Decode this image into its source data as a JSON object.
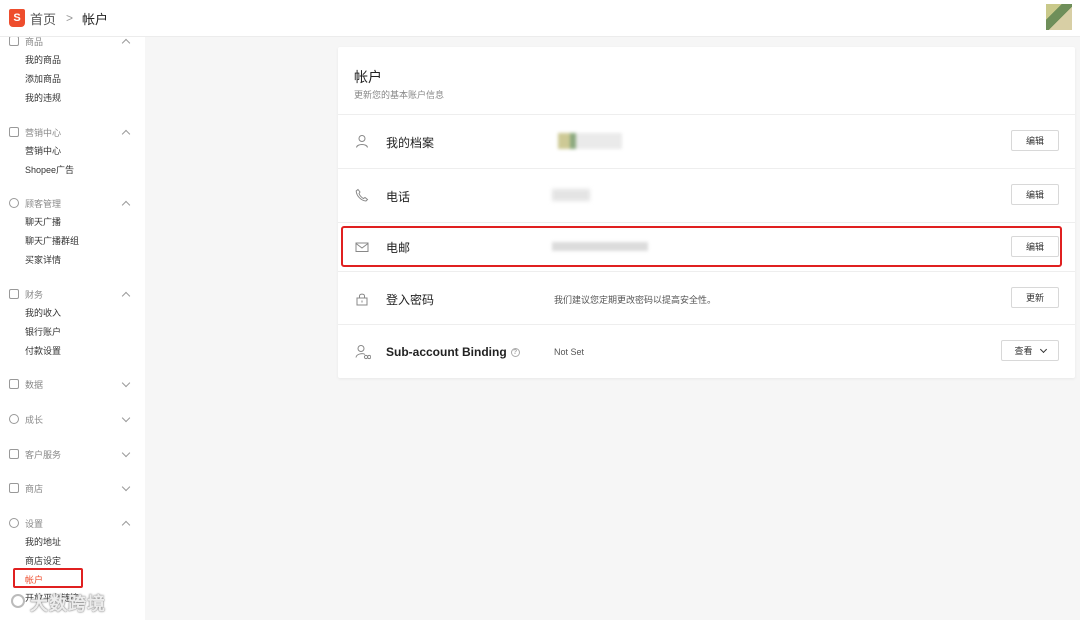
{
  "header": {
    "logo_letter": "S",
    "breadcrumb_home": "首页",
    "breadcrumb_sep": ">",
    "breadcrumb_current": "帐户"
  },
  "sidebar": {
    "groups": [
      {
        "label": "商品",
        "expanded": true,
        "items": [
          "我的商品",
          "添加商品",
          "我的违规"
        ]
      },
      {
        "label": "营销中心",
        "expanded": true,
        "items": [
          "营销中心",
          "Shopee广告"
        ]
      },
      {
        "label": "顾客管理",
        "expanded": true,
        "items": [
          "聊天广播",
          "聊天广播群组",
          "买家详情"
        ]
      },
      {
        "label": "财务",
        "expanded": true,
        "items": [
          "我的收入",
          "银行账户",
          "付款设置"
        ]
      },
      {
        "label": "数据",
        "expanded": false,
        "items": []
      },
      {
        "label": "成长",
        "expanded": false,
        "items": []
      },
      {
        "label": "客户服务",
        "expanded": false,
        "items": []
      },
      {
        "label": "商店",
        "expanded": false,
        "items": []
      },
      {
        "label": "设置",
        "expanded": true,
        "items": [
          "我的地址",
          "商店设定",
          "帐户",
          "开放平台链接"
        ]
      }
    ],
    "active_item": "帐户",
    "watermark": "大数跨境"
  },
  "account": {
    "title": "帐户",
    "subtitle": "更新您的基本账户信息",
    "rows": [
      {
        "label": "我的档案",
        "value": "",
        "button": "编辑",
        "icon": "user-icon"
      },
      {
        "label": "电话",
        "value": "",
        "button": "编辑",
        "icon": "phone-icon"
      },
      {
        "label": "电邮",
        "value": "",
        "button": "编辑",
        "icon": "mail-icon"
      },
      {
        "label": "登入密码",
        "value": "我们建议您定期更改密码以提高安全性。",
        "button": "更新",
        "icon": "lock-icon"
      },
      {
        "label": "Sub-account Binding",
        "value": "Not Set",
        "button": "查看",
        "icon": "sub-account-icon"
      }
    ]
  },
  "colors": {
    "brand": "#ee4d2d",
    "highlight": "#e02020"
  }
}
